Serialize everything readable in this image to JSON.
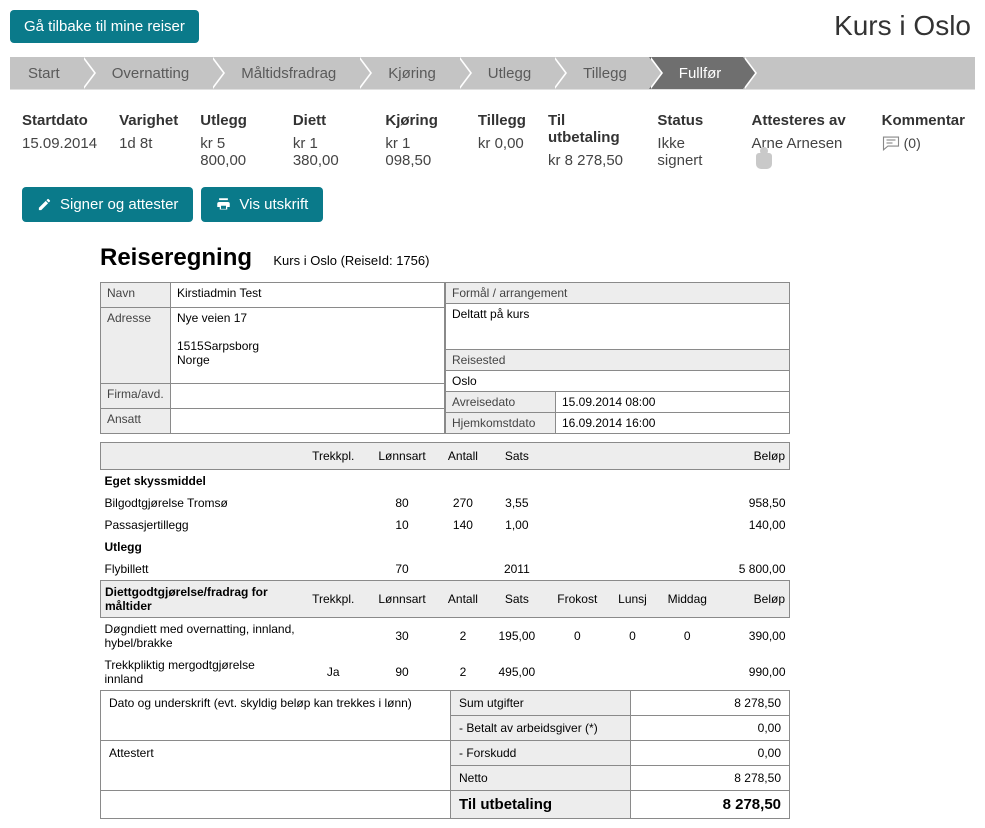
{
  "header": {
    "back_label": "Gå tilbake til mine reiser",
    "page_title": "Kurs i Oslo"
  },
  "wizard": {
    "steps": [
      {
        "label": "Start"
      },
      {
        "label": "Overnatting"
      },
      {
        "label": "Måltidsfradrag"
      },
      {
        "label": "Kjøring"
      },
      {
        "label": "Utlegg"
      },
      {
        "label": "Tillegg"
      },
      {
        "label": "Fullfør"
      }
    ],
    "active_index": 6
  },
  "summary": {
    "cols": [
      {
        "lbl": "Startdato",
        "val": "15.09.2014"
      },
      {
        "lbl": "Varighet",
        "val": "1d 8t"
      },
      {
        "lbl": "Utlegg",
        "val": "kr 5 800,00"
      },
      {
        "lbl": "Diett",
        "val": "kr 1 380,00"
      },
      {
        "lbl": "Kjøring",
        "val": "kr 1 098,50"
      },
      {
        "lbl": "Tillegg",
        "val": "kr 0,00"
      },
      {
        "lbl": "Til utbetaling",
        "val": "kr 8 278,50"
      },
      {
        "lbl": "Status",
        "val": "Ikke signert"
      },
      {
        "lbl": "Attesteres av",
        "val": "Arne Arnesen"
      },
      {
        "lbl": "Kommentar",
        "val": "(0)"
      }
    ]
  },
  "actions": {
    "sign_label": "Signer og attester",
    "print_label": "Vis utskrift"
  },
  "sheet": {
    "title": "Reiseregning",
    "subtitle": "Kurs i Oslo (ReiseId: 1756)",
    "left": {
      "navn_lbl": "Navn",
      "navn": "Kirstiadmin Test",
      "adresse_lbl": "Adresse",
      "adresse_l1": "Nye veien 17",
      "adresse_l2": "1515Sarpsborg",
      "adresse_l3": "Norge",
      "firma_lbl": "Firma/avd.",
      "firma": "",
      "ansatt_lbl": "Ansatt",
      "ansatt": ""
    },
    "right": {
      "formal_lbl": "Formål / arrangement",
      "formal": "Deltatt på kurs",
      "reisested_lbl": "Reisested",
      "reisested": "Oslo",
      "avreise_lbl": "Avreisedato",
      "avreise": "15.09.2014 08:00",
      "hjem_lbl": "Hjemkomstdato",
      "hjem": "16.09.2014 16:00"
    },
    "lines_header": {
      "trekkpl": "Trekkpl.",
      "lonnsart": "Lønnsart",
      "antall": "Antall",
      "sats": "Sats",
      "belop": "Beløp"
    },
    "section_eget": "Eget skyssmiddel",
    "eget_rows": [
      {
        "navn": "Bilgodtgjørelse Tromsø",
        "lonnsart": "80",
        "antall": "270",
        "sats": "3,55",
        "belop": "958,50"
      },
      {
        "navn": "Passasjertillegg",
        "lonnsart": "10",
        "antall": "140",
        "sats": "1,00",
        "belop": "140,00"
      }
    ],
    "section_utlegg": "Utlegg",
    "utlegg_rows": [
      {
        "navn": "Flybillett",
        "lonnsart": "70",
        "antall": "",
        "sats": "2011",
        "belop": "5 800,00"
      }
    ],
    "diett_header": {
      "title": "Diettgodtgjørelse/fradrag for måltider",
      "trekkpl": "Trekkpl.",
      "lonnsart": "Lønnsart",
      "antall": "Antall",
      "sats": "Sats",
      "frokost": "Frokost",
      "lunsj": "Lunsj",
      "middag": "Middag",
      "belop": "Beløp"
    },
    "diett_rows": [
      {
        "navn": "Døgndiett med overnatting, innland, hybel/brakke",
        "trekkpl": "",
        "lonnsart": "30",
        "antall": "2",
        "sats": "195,00",
        "frokost": "0",
        "lunsj": "0",
        "middag": "0",
        "belop": "390,00"
      },
      {
        "navn": "Trekkpliktig mergodtgjørelse innland",
        "trekkpl": "Ja",
        "lonnsart": "90",
        "antall": "2",
        "sats": "495,00",
        "frokost": "",
        "lunsj": "",
        "middag": "",
        "belop": "990,00"
      }
    ],
    "sign_text": "Dato og underskrift (evt. skyldig beløp kan trekkes i lønn)",
    "attestert_lbl": "Attestert",
    "totals": [
      {
        "lbl": "Sum utgifter",
        "val": "8 278,50"
      },
      {
        "lbl": "- Betalt av arbeidsgiver (*)",
        "val": "0,00"
      },
      {
        "lbl": "- Forskudd",
        "val": "0,00"
      },
      {
        "lbl": "Netto",
        "val": "8 278,50"
      }
    ],
    "grand": {
      "lbl": "Til utbetaling",
      "val": "8 278,50"
    }
  }
}
